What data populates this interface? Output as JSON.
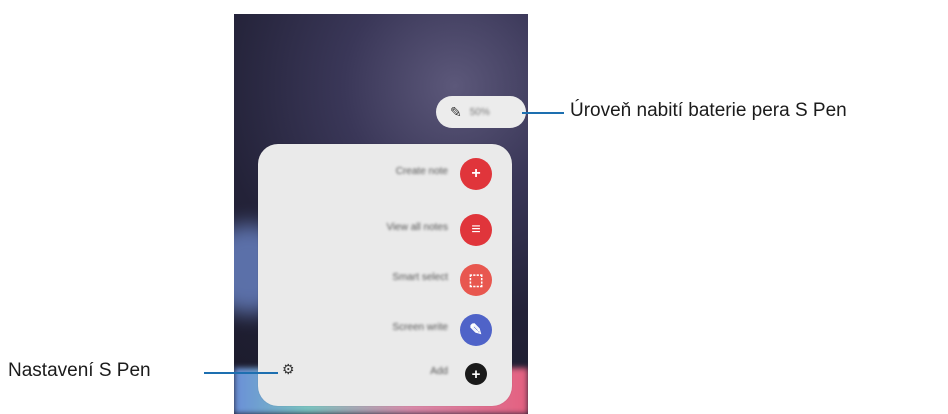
{
  "callouts": {
    "battery": "Úroveň nabití baterie pera S Pen",
    "settings": "Nastavení S Pen"
  },
  "battery_pill": {
    "icon": "pen-icon",
    "text": "50%"
  },
  "air_command": {
    "items": [
      {
        "label": "Create note",
        "icon": "create-note-icon",
        "color": "#e0353b",
        "glyph": "+"
      },
      {
        "label": "View all notes",
        "icon": "view-notes-icon",
        "color": "#e0353b",
        "glyph": "≡"
      },
      {
        "label": "Smart select",
        "icon": "smart-select-icon",
        "color": "#e8574f",
        "glyph": "⬚"
      },
      {
        "label": "Screen write",
        "icon": "screen-write-icon",
        "color": "#4f63c8",
        "glyph": "✎"
      },
      {
        "label": "Add",
        "icon": "add-icon",
        "color": "#1a1a1a",
        "glyph": "+"
      }
    ],
    "settings_icon": "gear-icon"
  }
}
